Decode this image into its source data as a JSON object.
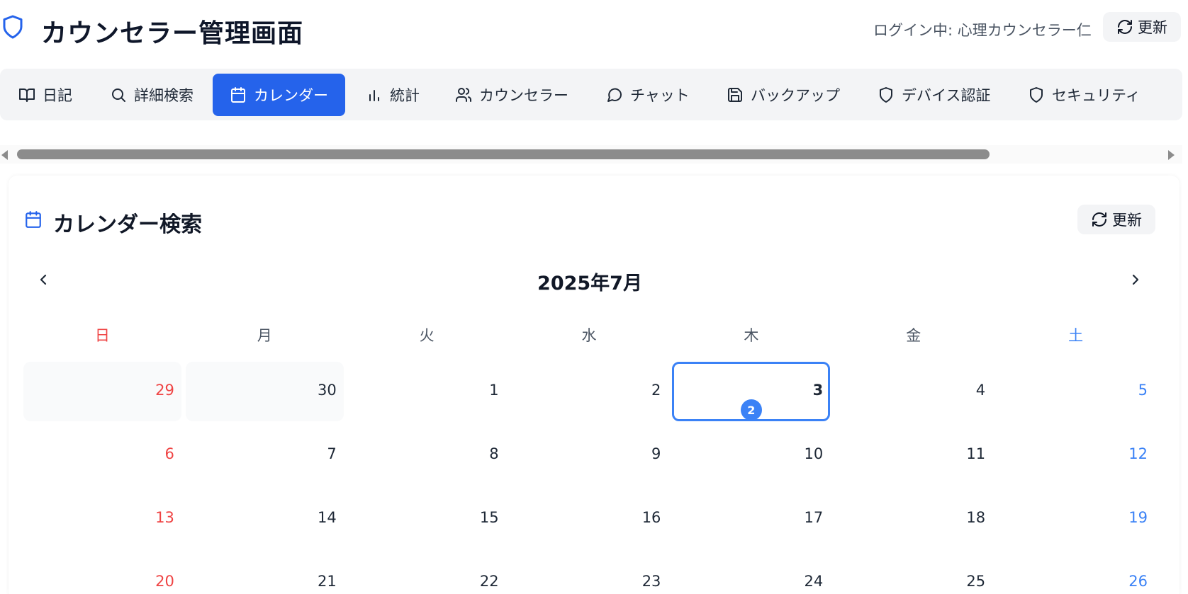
{
  "header": {
    "title": "カウンセラー管理画面",
    "login_text": "ログイン中: 心理カウンセラー仁",
    "refresh_label": "更新"
  },
  "tabs": [
    {
      "label": "日記",
      "icon": "book-open-icon"
    },
    {
      "label": "詳細検索",
      "icon": "search-icon"
    },
    {
      "label": "カレンダー",
      "icon": "calendar-icon",
      "active": true
    },
    {
      "label": "統計",
      "icon": "bar-chart-icon"
    },
    {
      "label": "カウンセラー",
      "icon": "users-icon"
    },
    {
      "label": "チャット",
      "icon": "message-circle-icon"
    },
    {
      "label": "バックアップ",
      "icon": "save-icon"
    },
    {
      "label": "デバイス認証",
      "icon": "shield-icon"
    },
    {
      "label": "セキュリティ",
      "icon": "shield-icon"
    }
  ],
  "calendar": {
    "title": "カレンダー検索",
    "refresh_label": "更新",
    "month_label": "2025年7月",
    "weekdays": [
      "日",
      "月",
      "火",
      "水",
      "木",
      "金",
      "土"
    ],
    "weeks": [
      [
        {
          "d": "29",
          "other": true
        },
        {
          "d": "30",
          "other": true
        },
        {
          "d": "1"
        },
        {
          "d": "2"
        },
        {
          "d": "3",
          "today": true,
          "count": "2"
        },
        {
          "d": "4"
        },
        {
          "d": "5"
        }
      ],
      [
        {
          "d": "6"
        },
        {
          "d": "7"
        },
        {
          "d": "8"
        },
        {
          "d": "9"
        },
        {
          "d": "10"
        },
        {
          "d": "11"
        },
        {
          "d": "12"
        }
      ],
      [
        {
          "d": "13"
        },
        {
          "d": "14"
        },
        {
          "d": "15"
        },
        {
          "d": "16"
        },
        {
          "d": "17"
        },
        {
          "d": "18"
        },
        {
          "d": "19"
        }
      ],
      [
        {
          "d": "20"
        },
        {
          "d": "21"
        },
        {
          "d": "22"
        },
        {
          "d": "23"
        },
        {
          "d": "24"
        },
        {
          "d": "25"
        },
        {
          "d": "26"
        }
      ]
    ]
  },
  "colors": {
    "accent": "#2563eb",
    "sunday": "#ef4444",
    "saturday": "#3b82f6",
    "tab_bar_bg": "#f3f4f6"
  }
}
